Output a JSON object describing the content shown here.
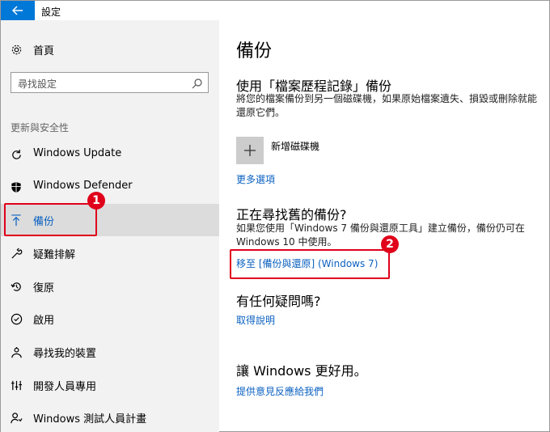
{
  "window": {
    "title": "設定"
  },
  "sidebar": {
    "home_label": "首頁",
    "search_placeholder": "尋找設定",
    "section_label": "更新與安全性",
    "items": [
      {
        "label": "Windows Update",
        "icon": "refresh-icon"
      },
      {
        "label": "Windows Defender",
        "icon": "shield-icon"
      },
      {
        "label": "備份",
        "icon": "backup-arrow-icon",
        "active": true
      },
      {
        "label": "疑難排解",
        "icon": "wrench-icon"
      },
      {
        "label": "復原",
        "icon": "recovery-icon"
      },
      {
        "label": "啟用",
        "icon": "check-circle-icon"
      },
      {
        "label": "尋找我的裝置",
        "icon": "person-location-icon"
      },
      {
        "label": "開發人員專用",
        "icon": "developer-icon"
      },
      {
        "label": "Windows 測試人員計畫",
        "icon": "insider-icon"
      }
    ]
  },
  "main": {
    "title": "備份",
    "file_history": {
      "heading": "使用「檔案歷程記錄」備份",
      "description": "將您的檔案備份到另一個磁碟機，如果原始檔案遺失、損毀或刪除就能還原它們。",
      "add_drive_label": "新增磁碟機",
      "more_options_link": "更多選項"
    },
    "older_backup": {
      "heading": "正在尋找舊的備份?",
      "description": "如果您使用「Windows 7 備份與還原工具」建立備份，備份仍可在 Windows 10 中使用。",
      "link": "移至 [備份與還原] (Windows 7)"
    },
    "questions": {
      "heading": "有任何疑問嗎?",
      "link": "取得說明"
    },
    "feedback": {
      "heading": "讓 Windows 更好用。",
      "link": "提供意見反應給我們"
    }
  },
  "annotations": {
    "badge1": "1",
    "badge2": "2",
    "color": "#e0001a"
  },
  "colors": {
    "accent": "#0078d7",
    "link": "#0b61c0",
    "sidebar_bg": "#f2f2f2",
    "active_bg": "#dcdcdc"
  }
}
